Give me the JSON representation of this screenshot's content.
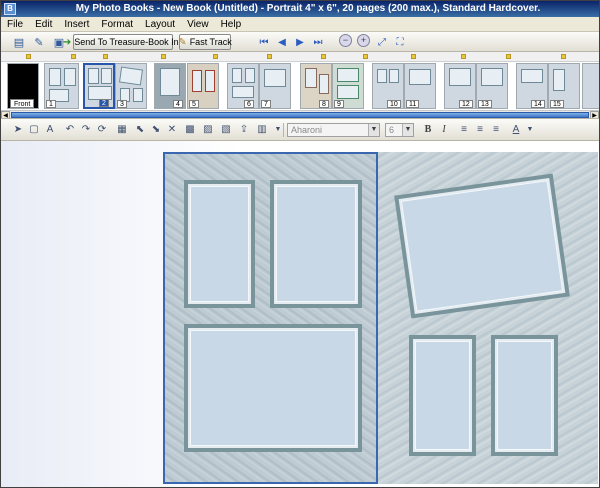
{
  "window": {
    "title": "My Photo Books - New Book (Untitled) - Portrait 4\" x 6\", 20 pages (200 max.), Standard Hardcover.",
    "app_icon": "B"
  },
  "menu": [
    "File",
    "Edit",
    "Insert",
    "Format",
    "Layout",
    "View",
    "Help"
  ],
  "toolbar": {
    "send_label": "Send To Treasure-Book Inc",
    "fasttrack_label": "Fast Track"
  },
  "thumbnails": {
    "front_label": "Front",
    "pages": [
      "1",
      "2",
      "3",
      "4",
      "5",
      "6",
      "7",
      "8",
      "9",
      "10",
      "11",
      "12",
      "13",
      "14",
      "15"
    ],
    "selected": "2"
  },
  "format_bar": {
    "font_name": "Aharoni",
    "font_size": "6",
    "bold": "B",
    "italic": "I"
  },
  "colors": {
    "selection": "#3a68b0",
    "frame": "#7a949c",
    "photo_slot": "#c9d8e6"
  }
}
